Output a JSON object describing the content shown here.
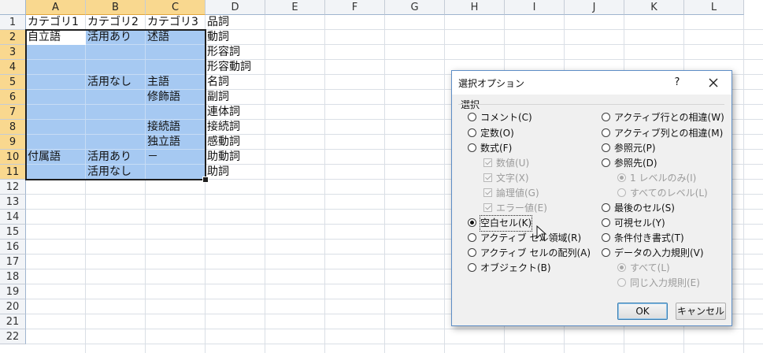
{
  "columns": [
    "A",
    "B",
    "C",
    "D",
    "E",
    "F",
    "G",
    "H",
    "I",
    "J",
    "K",
    "L"
  ],
  "rows": [
    "1",
    "2",
    "3",
    "4",
    "5",
    "6",
    "7",
    "8",
    "9",
    "10",
    "11",
    "12",
    "13",
    "14",
    "15",
    "16",
    "17",
    "18",
    "19",
    "20",
    "21",
    "22"
  ],
  "cells": {
    "A1": "カテゴリ1",
    "B1": "カテゴリ2",
    "C1": "カテゴリ3",
    "D1": "品詞",
    "A2": "自立語",
    "B2": "活用あり",
    "C2": "述語",
    "D2": "動詞",
    "D3": "形容詞",
    "D4": "形容動詞",
    "B5": "活用なし",
    "C5": "主語",
    "D5": "名詞",
    "C6": "修飾語",
    "D6": "副詞",
    "D7": "連体詞",
    "C8": "接続語",
    "D8": "接続詞",
    "C9": "独立語",
    "D9": "感動詞",
    "A10": "付属語",
    "B10": "活用あり",
    "C10": "－",
    "D10": "助動詞",
    "B11": "活用なし",
    "D11": "助詞"
  },
  "dialog": {
    "title": "選択オプション",
    "help": "?",
    "group": "選択",
    "left_options": [
      {
        "label": "コメント(C)",
        "checked": false,
        "disabled": false
      },
      {
        "label": "定数(O)",
        "checked": false,
        "disabled": false
      },
      {
        "label": "数式(F)",
        "checked": false,
        "disabled": false
      },
      {
        "label": "数値(U)",
        "type": "checkbox",
        "disabled": true
      },
      {
        "label": "文字(X)",
        "type": "checkbox",
        "disabled": true
      },
      {
        "label": "論理値(G)",
        "type": "checkbox",
        "disabled": true
      },
      {
        "label": "エラー値(E)",
        "type": "checkbox",
        "disabled": true
      },
      {
        "label": "空白セル(K)",
        "checked": true,
        "disabled": false
      },
      {
        "label": "アクティブ セル領域(R)",
        "checked": false,
        "disabled": false
      },
      {
        "label": "アクティブ セルの配列(A)",
        "checked": false,
        "disabled": false
      },
      {
        "label": "オブジェクト(B)",
        "checked": false,
        "disabled": false
      }
    ],
    "right_options": [
      {
        "label": "アクティブ行との相違(W)",
        "checked": false,
        "disabled": false
      },
      {
        "label": "アクティブ列との相違(M)",
        "checked": false,
        "disabled": false
      },
      {
        "label": "参照元(P)",
        "checked": false,
        "disabled": false
      },
      {
        "label": "参照先(D)",
        "checked": false,
        "disabled": false
      },
      {
        "label": "1 レベルのみ(I)",
        "checked": true,
        "disabled": true
      },
      {
        "label": "すべてのレベル(L)",
        "checked": false,
        "disabled": true
      },
      {
        "label": "最後のセル(S)",
        "checked": false,
        "disabled": false
      },
      {
        "label": "可視セル(Y)",
        "checked": false,
        "disabled": false
      },
      {
        "label": "条件付き書式(T)",
        "checked": false,
        "disabled": false
      },
      {
        "label": "データの入力規則(V)",
        "checked": false,
        "disabled": false
      },
      {
        "label": "すべて(L)",
        "checked": true,
        "disabled": true
      },
      {
        "label": "同じ入力規則(E)",
        "checked": false,
        "disabled": true
      }
    ],
    "ok_label": "OK",
    "cancel_label": "キャンセル"
  }
}
